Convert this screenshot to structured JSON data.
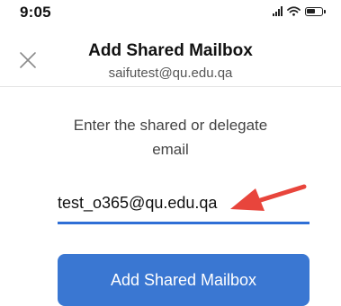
{
  "status_bar": {
    "time": "9:05",
    "icons": [
      "signal-icon",
      "wifi-icon",
      "battery-icon"
    ]
  },
  "header": {
    "close_icon": "close-icon",
    "title": "Add Shared Mailbox",
    "subtitle": "saifutest@qu.edu.qa"
  },
  "form": {
    "instruction": "Enter the shared or delegate email",
    "email_value": "test_o365@qu.edu.qa",
    "submit_label": "Add Shared Mailbox"
  },
  "annotation": {
    "arrow_color": "#e8453c",
    "arrow_icon": "arrow-icon"
  },
  "colors": {
    "accent": "#3a77d2",
    "underline": "#2f6fd6"
  }
}
